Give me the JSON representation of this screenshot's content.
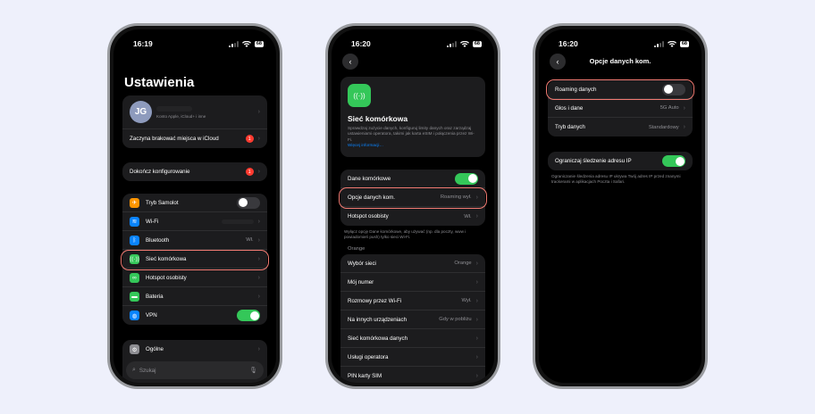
{
  "colors": {
    "background": "#eef0fb",
    "accent_green": "#34c759",
    "highlight": "#f07a72",
    "badge_red": "#ff3b30",
    "link_blue": "#0a84ff"
  },
  "screen1": {
    "time": "16:19",
    "battery": "68",
    "title": "Ustawienia",
    "profile": {
      "initials": "JG",
      "subtitle": "Konto Apple, iCloud+ i inne"
    },
    "icloud_row": {
      "label": "Zaczyna brakować miejsca w iCloud",
      "badge": "1"
    },
    "setup_row": {
      "label": "Dokończ konfigurowanie",
      "badge": "1"
    },
    "items": [
      {
        "label": "Tryb Samolot",
        "icon": "airplane-icon",
        "color": "#ff9500",
        "value": "",
        "toggle": "off"
      },
      {
        "label": "Wi-Fi",
        "icon": "wifi-icon",
        "color": "#0a84ff",
        "value": ""
      },
      {
        "label": "Bluetooth",
        "icon": "bluetooth-icon",
        "color": "#0a84ff",
        "value": "Wł."
      },
      {
        "label": "Sieć komórkowa",
        "icon": "cellular-icon",
        "color": "#34c759",
        "value": ""
      },
      {
        "label": "Hotspot osobisty",
        "icon": "hotspot-icon",
        "color": "#34c759",
        "value": ""
      },
      {
        "label": "Bateria",
        "icon": "battery-icon",
        "color": "#34c759",
        "value": ""
      },
      {
        "label": "VPN",
        "icon": "vpn-icon",
        "color": "#0a84ff",
        "value": "",
        "toggle": "on"
      }
    ],
    "general": {
      "label": "Ogólne"
    },
    "search_placeholder": "Szukaj"
  },
  "screen2": {
    "time": "16:20",
    "battery": "68",
    "hero": {
      "title": "Sieć komórkowa",
      "description": "Sprawdzaj zużycie danych, konfiguruj limity danych oraz zarządzaj ustawieniami operatora, takimi jak karta eSIM i połączenia przez Wi-Fi.",
      "link": "Więcej informacji…"
    },
    "data_rows": [
      {
        "label": "Dane komórkowe",
        "value": "",
        "toggle": "on"
      },
      {
        "label": "Opcje danych kom.",
        "value": "Roaming wył."
      },
      {
        "label": "Hotspot osobisty",
        "value": "Wł."
      }
    ],
    "data_note": "Wyłącz opcję Dane komórkowe, aby używać (np. dla poczty, www i powiadomień push) tylko sieci Wi-Fi.",
    "section_label": "Orange",
    "carrier_rows": [
      {
        "label": "Wybór sieci",
        "value": "Orange"
      },
      {
        "label": "Mój numer",
        "value": ""
      },
      {
        "label": "Rozmowy przez Wi-Fi",
        "value": "Wył."
      },
      {
        "label": "Na innych urządzeniach",
        "value": "Gdy w pobliżu"
      },
      {
        "label": "Sieć komórkowa danych",
        "value": ""
      },
      {
        "label": "Usługi operatora",
        "value": ""
      },
      {
        "label": "PIN karty SIM",
        "value": ""
      }
    ]
  },
  "screen3": {
    "time": "16:20",
    "battery": "68",
    "title": "Opcje danych kom.",
    "rows": [
      {
        "label": "Roaming danych",
        "value": "",
        "toggle": "off"
      },
      {
        "label": "Głos i dane",
        "value": "5G Auto"
      },
      {
        "label": "Tryb danych",
        "value": "Standardowy"
      }
    ],
    "ip_row": {
      "label": "Ograniczaj śledzenie adresu IP",
      "toggle": "on"
    },
    "ip_note": "Ograniczanie śledzenia adresu IP ukrywa Twój adres IP przed znanymi trackerami w aplikacjach Poczta i Safari."
  }
}
